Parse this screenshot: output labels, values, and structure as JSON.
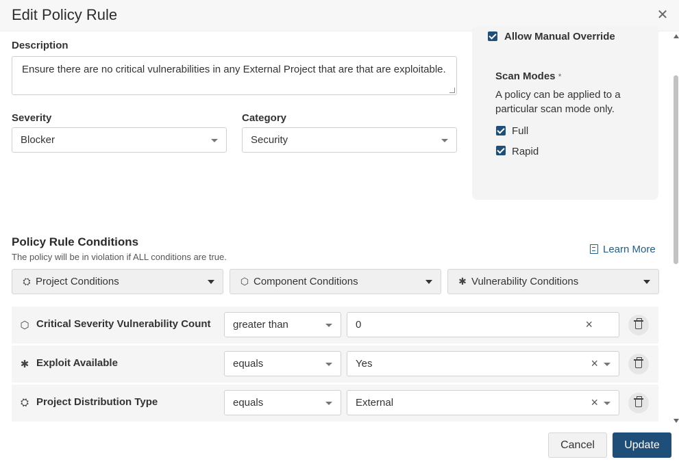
{
  "dialog": {
    "title": "Edit Policy Rule"
  },
  "description": {
    "label": "Description",
    "value": "Ensure there are no critical vulnerabilities in any External Project that are that are exploitable."
  },
  "severity": {
    "label": "Severity",
    "value": "Blocker"
  },
  "category": {
    "label": "Category",
    "value": "Security"
  },
  "side": {
    "allow_override": "Allow Manual Override",
    "scan_modes_label": "Scan Modes",
    "required_mark": "*",
    "scan_modes_help": "A policy can be applied to a particular scan mode only.",
    "modes": [
      "Full",
      "Rapid"
    ]
  },
  "conditions": {
    "title": "Policy Rule Conditions",
    "subtitle": "The policy will be in violation if ALL conditions are true.",
    "learn_more": "Learn More",
    "dropdowns": [
      "Project Conditions",
      "Component Conditions",
      "Vulnerability Conditions"
    ],
    "rows": [
      {
        "label": "Critical Severity Vulnerability Count",
        "operator": "greater than",
        "value": "0"
      },
      {
        "label": "Exploit Available",
        "operator": "equals",
        "value": "Yes"
      },
      {
        "label": "Project Distribution Type",
        "operator": "equals",
        "value": "External"
      }
    ]
  },
  "footer": {
    "cancel": "Cancel",
    "update": "Update"
  },
  "colors": {
    "primary": "#1f4e79",
    "link": "#1f5d8f"
  }
}
